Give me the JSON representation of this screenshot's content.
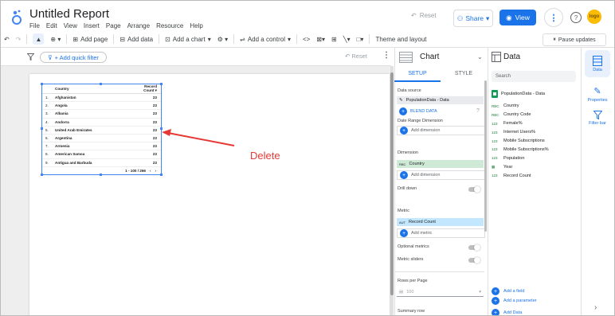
{
  "app": {
    "title": "Untitled Report",
    "menu": [
      "File",
      "Edit",
      "View",
      "Insert",
      "Page",
      "Arrange",
      "Resource",
      "Help"
    ],
    "reset_label": "Reset",
    "share_label": "Share",
    "view_label": "View",
    "help_glyph": "?",
    "avatar_text": "logo"
  },
  "toolbar": {
    "add_page": "Add page",
    "add_data": "Add data",
    "add_chart": "Add a chart",
    "add_control": "Add a control",
    "theme": "Theme and layout",
    "pause": "Pause updates"
  },
  "filterbar": {
    "add_filter": "+ Add quick filter",
    "reset": "Reset"
  },
  "table": {
    "headers": {
      "country": "Country",
      "count": "Record Count"
    },
    "rows": [
      {
        "num": "1.",
        "country": "Afghanistan",
        "count": "23"
      },
      {
        "num": "2.",
        "country": "Angola",
        "count": "23"
      },
      {
        "num": "3.",
        "country": "Albania",
        "count": "23"
      },
      {
        "num": "4.",
        "country": "Andorra",
        "count": "23"
      },
      {
        "num": "5.",
        "country": "United Arab Emirates",
        "count": "23"
      },
      {
        "num": "6.",
        "country": "Argentina",
        "count": "23"
      },
      {
        "num": "7.",
        "country": "Armenia",
        "count": "23"
      },
      {
        "num": "8.",
        "country": "American Samoa",
        "count": "23"
      },
      {
        "num": "9.",
        "country": "Antigua and Barbuda",
        "count": "23"
      }
    ],
    "pagination": "1 - 100 / 266"
  },
  "annotation": {
    "label": "Delete",
    "color": "#e53935"
  },
  "properties": {
    "title": "Chart",
    "tabs": {
      "setup": "SETUP",
      "style": "STYLE"
    },
    "data_source_label": "Data source",
    "data_source": "PopulationData - Data",
    "blend": "BLEND DATA",
    "date_range": "Date Range Dimension",
    "add_dimension": "Add dimension",
    "dimension_label": "Dimension",
    "dimension_field": "Country",
    "dimension_type": "RBC",
    "drill_down": "Drill down",
    "metric_label": "Metric",
    "metric_field": "Record Count",
    "metric_type": "AUT",
    "add_metric": "Add metric",
    "optional_metrics": "Optional metrics",
    "metric_sliders": "Metric sliders",
    "rows_per_page": "Rows per Page",
    "rows_value": "100",
    "summary_row": "Summary row"
  },
  "data_panel": {
    "title": "Data",
    "search_placeholder": "Search",
    "source": "PopulationData - Data",
    "fields": [
      {
        "type": "RBC",
        "name": "Country"
      },
      {
        "type": "RBC",
        "name": "Country Code"
      },
      {
        "type": "123",
        "name": "Female%"
      },
      {
        "type": "123",
        "name": "Internet Users%"
      },
      {
        "type": "123",
        "name": "Mobile Subscriptions"
      },
      {
        "type": "123",
        "name": "Mobile Subscriptions%"
      },
      {
        "type": "123",
        "name": "Population"
      },
      {
        "type": "cal",
        "name": "Year"
      },
      {
        "type": "123",
        "name": "Record Count"
      }
    ],
    "add_field": "Add a field",
    "add_parameter": "Add a parameter",
    "add_data": "Add Data"
  },
  "rail": {
    "data": "Data",
    "properties": "Properties",
    "filter_bar": "Filter bar"
  },
  "colors": {
    "accent": "#1a73e8",
    "selection": "#4285f4",
    "dim_chip": "#ceead6",
    "metric_chip": "#c2e7ff"
  }
}
